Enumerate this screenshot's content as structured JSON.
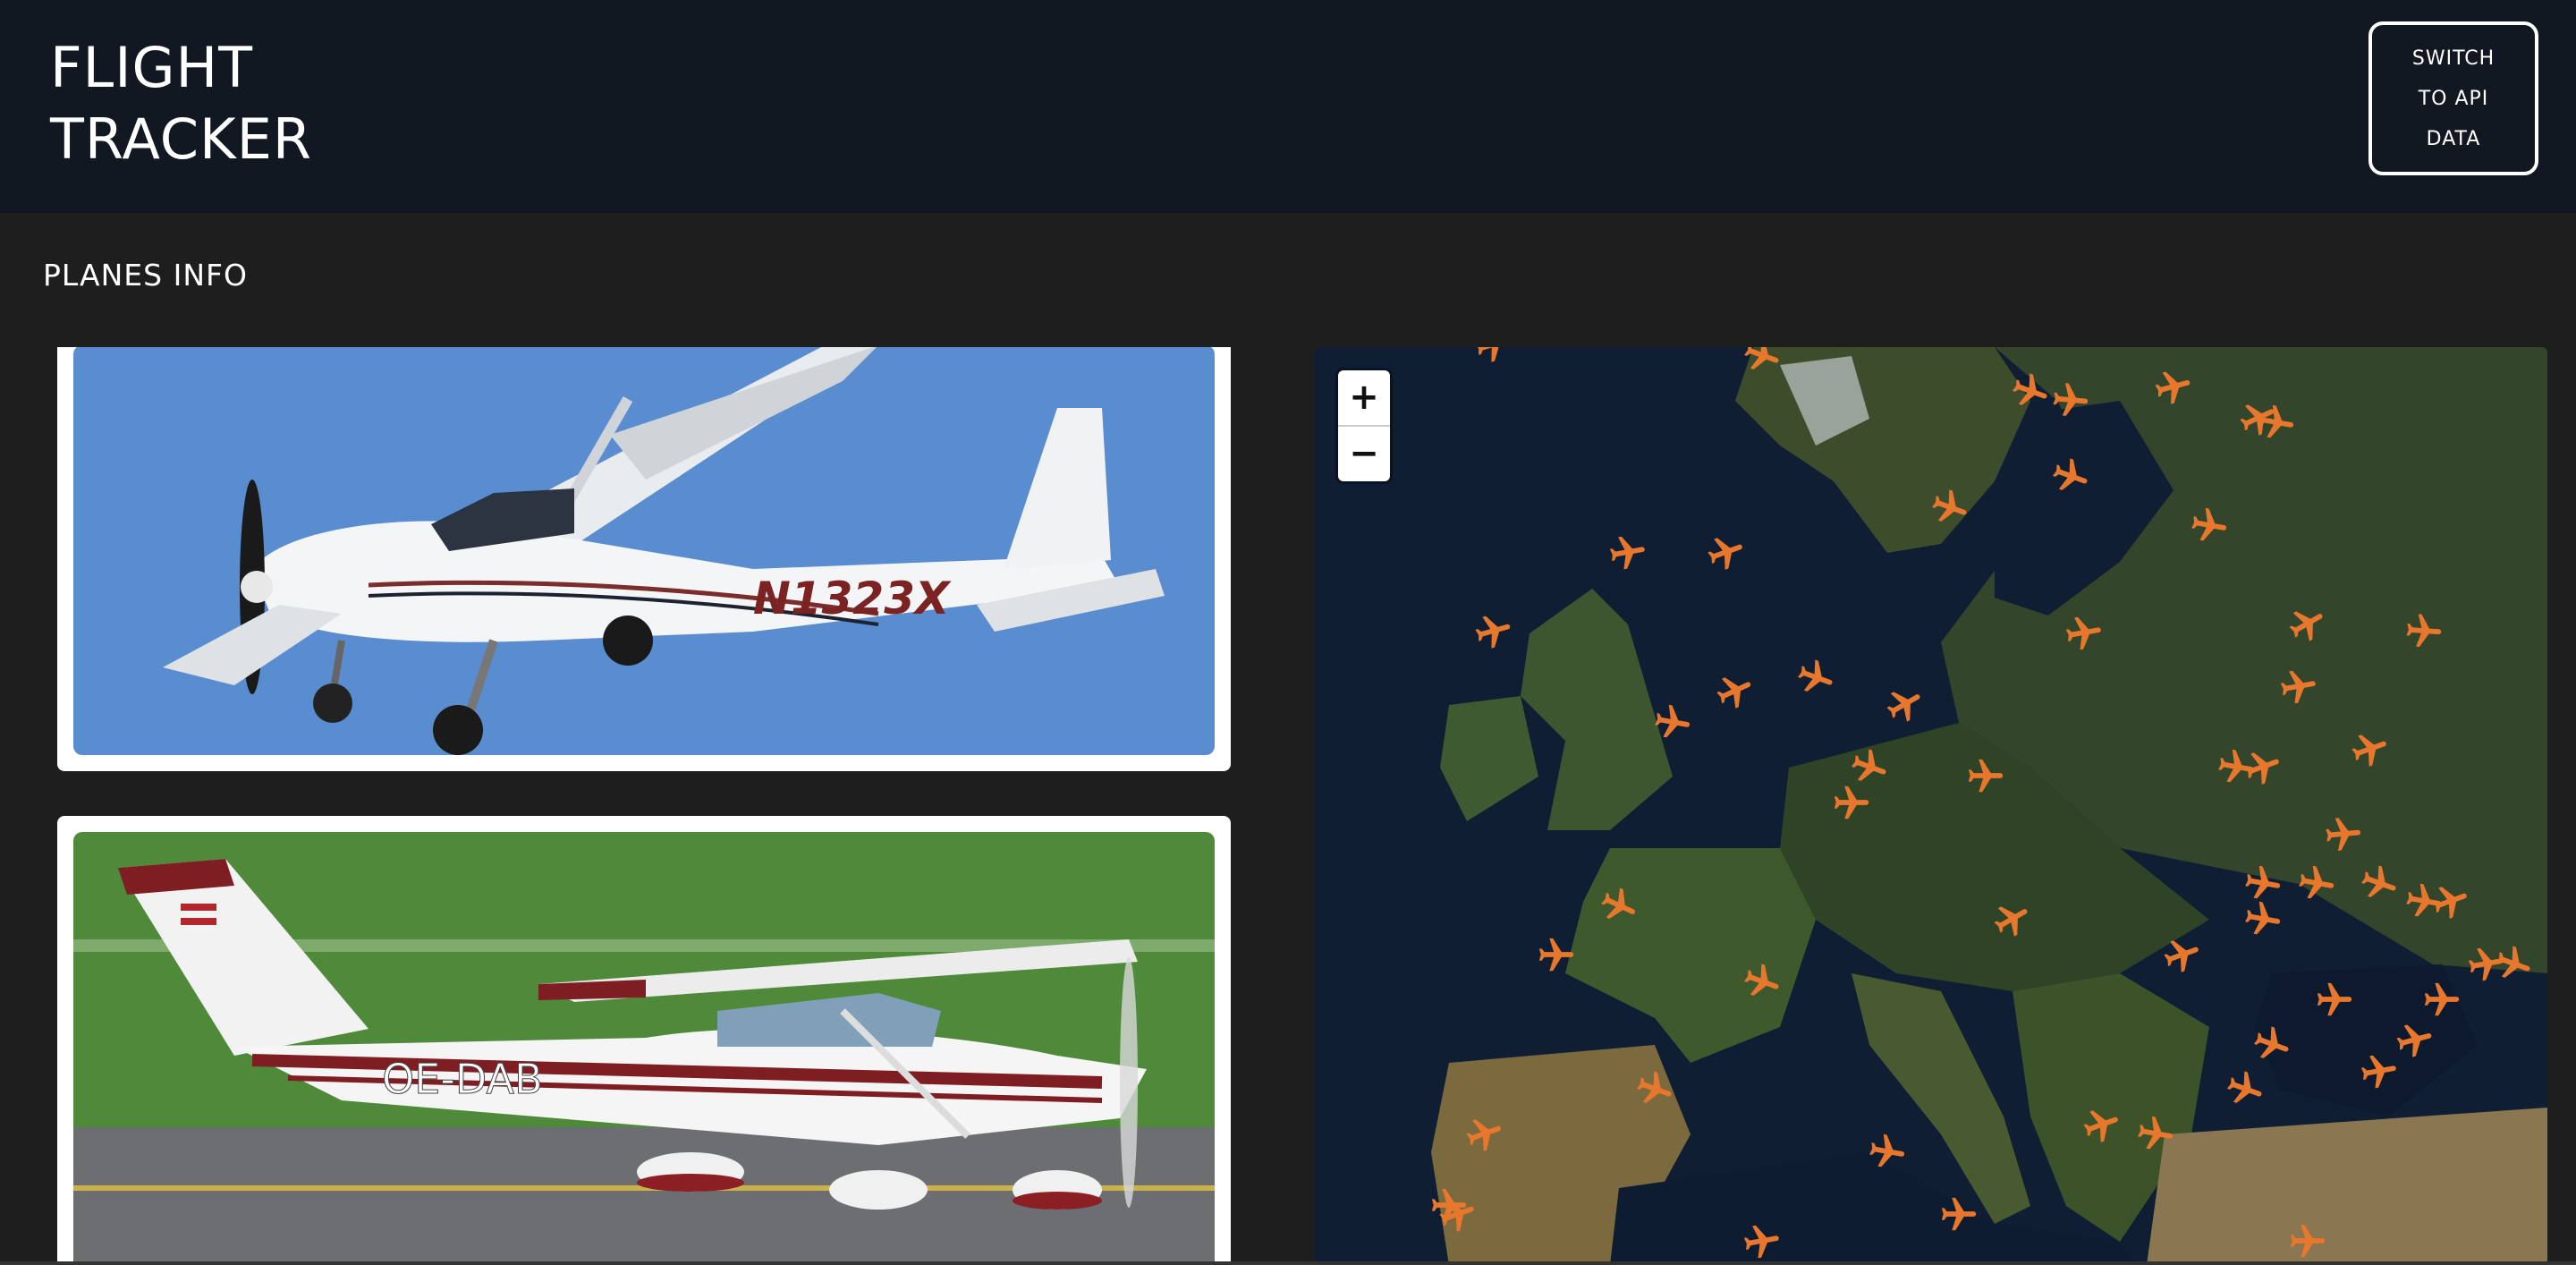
{
  "header": {
    "title_line1": "FLIGHT",
    "title_line2": "TRACKER",
    "switch_line1": "SWITCH",
    "switch_line2": "TO API",
    "switch_line3": "DATA"
  },
  "main": {
    "section_title": "PLANES INFO",
    "planes": [
      {
        "registration": "N1323X",
        "image": "plane-photo-1"
      },
      {
        "registration": "OE-DAB",
        "image": "plane-photo-2"
      }
    ]
  },
  "map": {
    "zoom_in": "+",
    "zoom_out": "−",
    "marker_color": "#e8772e",
    "marker_icon": "airplane-icon"
  }
}
